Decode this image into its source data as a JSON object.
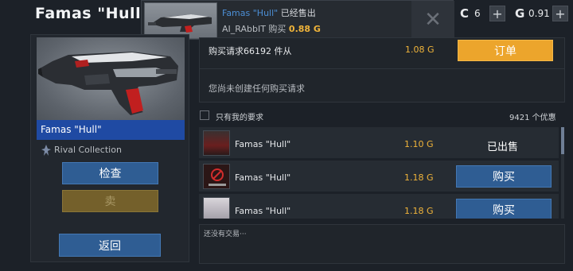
{
  "header": {
    "title": "Famas \"Hull\""
  },
  "notification": {
    "item_name": "Famas \"Hull\"",
    "sold_text": "已经售出",
    "buyer": "AI_RAbbIT",
    "bought_text": "购买",
    "price": "0.88 G",
    "close_icon": "close-icon"
  },
  "currency": {
    "credits_symbol": "C",
    "credits_value": "6",
    "gold_symbol": "G",
    "gold_value": "0.91",
    "plus_label": "+"
  },
  "item": {
    "name": "Famas \"Hull\"",
    "collection": "Rival Collection",
    "inspect_label": "检查",
    "sell_label": "卖",
    "back_label": "返回"
  },
  "buy_requests": {
    "label": "购买请求66192 件从",
    "price": "1.08 G",
    "order_label": "订单",
    "empty_text": "您尚未创建任何购买请求"
  },
  "filter": {
    "mine_only_label": "只有我的要求",
    "offer_count": "9421 个优惠"
  },
  "listings": [
    {
      "name": "Famas \"Hull\"",
      "price": "1.10 G",
      "status": "已出售",
      "action": ""
    },
    {
      "name": "Famas \"Hull\"",
      "price": "1.18 G",
      "status": "",
      "action": "购买"
    },
    {
      "name": "Famas \"Hull\"",
      "price": "1.18 G",
      "status": "",
      "action": "购买"
    }
  ],
  "trades": {
    "empty_text": "还没有交易···"
  },
  "colors": {
    "accent_blue": "#2f5d93",
    "gold": "#f0b43a",
    "order_orange": "#eca52c",
    "name_bar": "#1f4aa3"
  }
}
